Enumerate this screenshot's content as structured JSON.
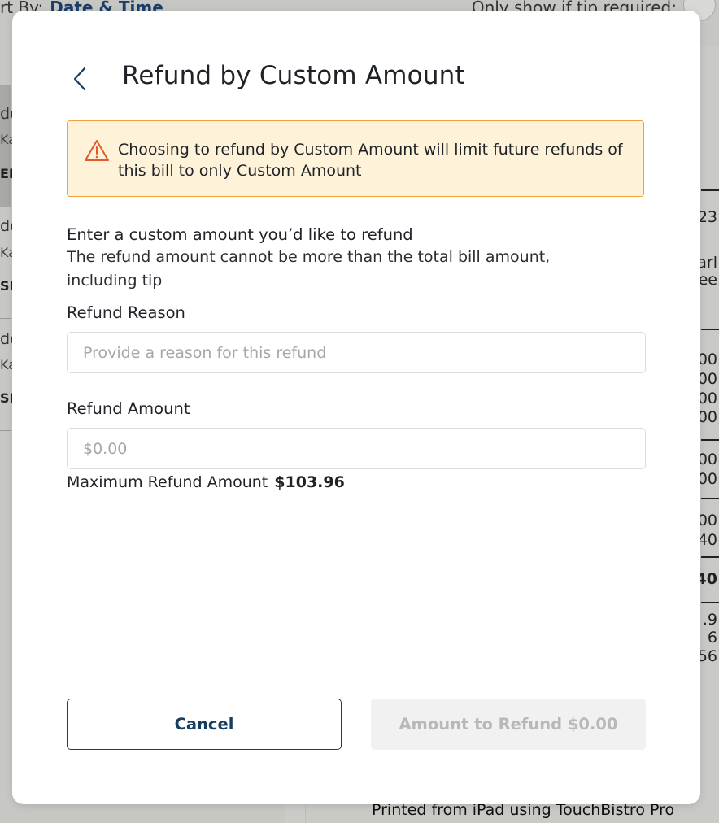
{
  "background": {
    "sort_label": "rt By:",
    "sort_value": "Date & Time",
    "tip_label": "Only show if tip required:",
    "footer_text": "Printed from iPad using TouchBistro Pro",
    "left_fragments": [
      "de",
      "Ka",
      "EF",
      "de",
      "Ka",
      "SH",
      "de",
      "Ka",
      "SH"
    ],
    "right_fragments": [
      "23",
      "arl",
      "ee",
      "00",
      "00",
      "00",
      "00",
      "00",
      "00",
      "00",
      "40",
      "40",
      ".9",
      "6",
      "56"
    ]
  },
  "modal": {
    "title": "Refund by Custom Amount",
    "back_icon": "chevron-left-icon",
    "warning": {
      "icon": "warning-triangle-icon",
      "text": "Choosing to refund by Custom Amount will limit future refunds of this bill to only Custom Amount"
    },
    "instruction_heading": "Enter a custom amount you’d like to refund",
    "instruction_sub": "The refund amount cannot be more than the total bill amount, including tip",
    "reason": {
      "label": "Refund Reason",
      "value": "",
      "placeholder": "Provide a reason for this refund"
    },
    "amount": {
      "label": "Refund Amount",
      "value": "",
      "placeholder": "$0.00"
    },
    "max_refund_label": "Maximum Refund Amount",
    "max_refund_value": "$103.96",
    "cancel_label": "Cancel",
    "submit_label": "Amount to Refund $0.00"
  },
  "colors": {
    "primary": "#163e61",
    "warning_bg": "#fef2d9",
    "warning_border": "#f0a13a",
    "warning_icon": "#e05a2b",
    "disabled_bg": "#f1f1f1",
    "disabled_text": "#b7b8ba"
  }
}
